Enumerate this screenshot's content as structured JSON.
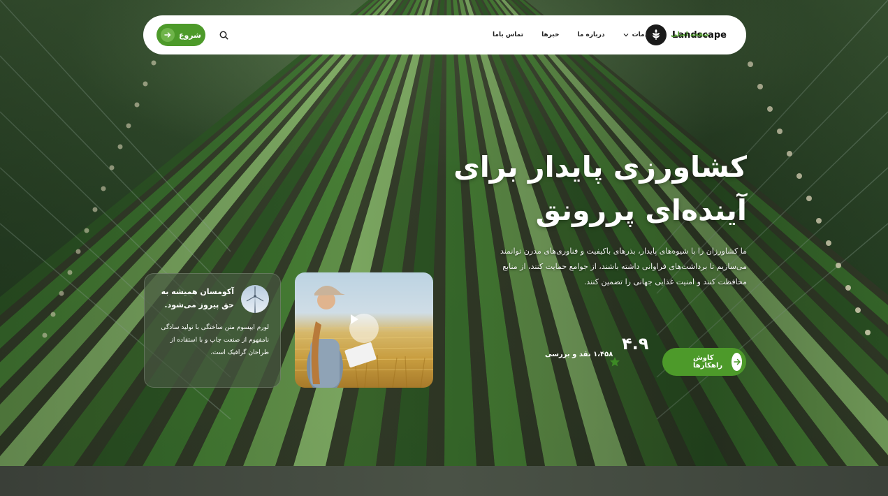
{
  "navbar": {
    "brand": "Landscape",
    "start_button": "شروع",
    "menu": [
      {
        "label": "صفحه اصلی",
        "active": true
      },
      {
        "label": "خدمات",
        "has_dropdown": true
      },
      {
        "label": "درباره ما"
      },
      {
        "label": "خبرها"
      },
      {
        "label": "تماس باما"
      }
    ]
  },
  "hero": {
    "title_line1": "کشاورزی پایدار برای",
    "title_line2": "آینده‌ای پررونق",
    "description_line1": "ما کشاورزان را با شیوه‌های پایدار، بذرهای باکیفیت و فناوری‌های مدرن توانمند",
    "description_line2": "می‌سازیم تا برداشت‌های فراوانی داشته باشند، از جوامع حمایت کنند، از منابع",
    "description_line3": "محافظت کنند و امنیت غذایی جهانی را تضمین کنند.",
    "cta_button": "کاوش راهکارها",
    "rating_value": "۴.۹",
    "rating_label": "۱،۴۵۸ نقد و بررسی"
  },
  "info_card": {
    "title": "آکومسان همیشه به حق پیروز می‌شود.",
    "body": "لورم ایپسوم متن ساختگی با تولید سادگی نامفهوم از صنعت چاپ و با استفاده از طراحان گرافیک است."
  },
  "colors": {
    "accent": "#4d9a2a",
    "navbar_bg": "#ffffff",
    "text_light": "#ffffff"
  },
  "icons": [
    "arrow-right-icon",
    "search-icon",
    "chevron-down-icon",
    "leaf-logo-icon",
    "play-icon",
    "star-icon",
    "wind-turbine-icon"
  ]
}
